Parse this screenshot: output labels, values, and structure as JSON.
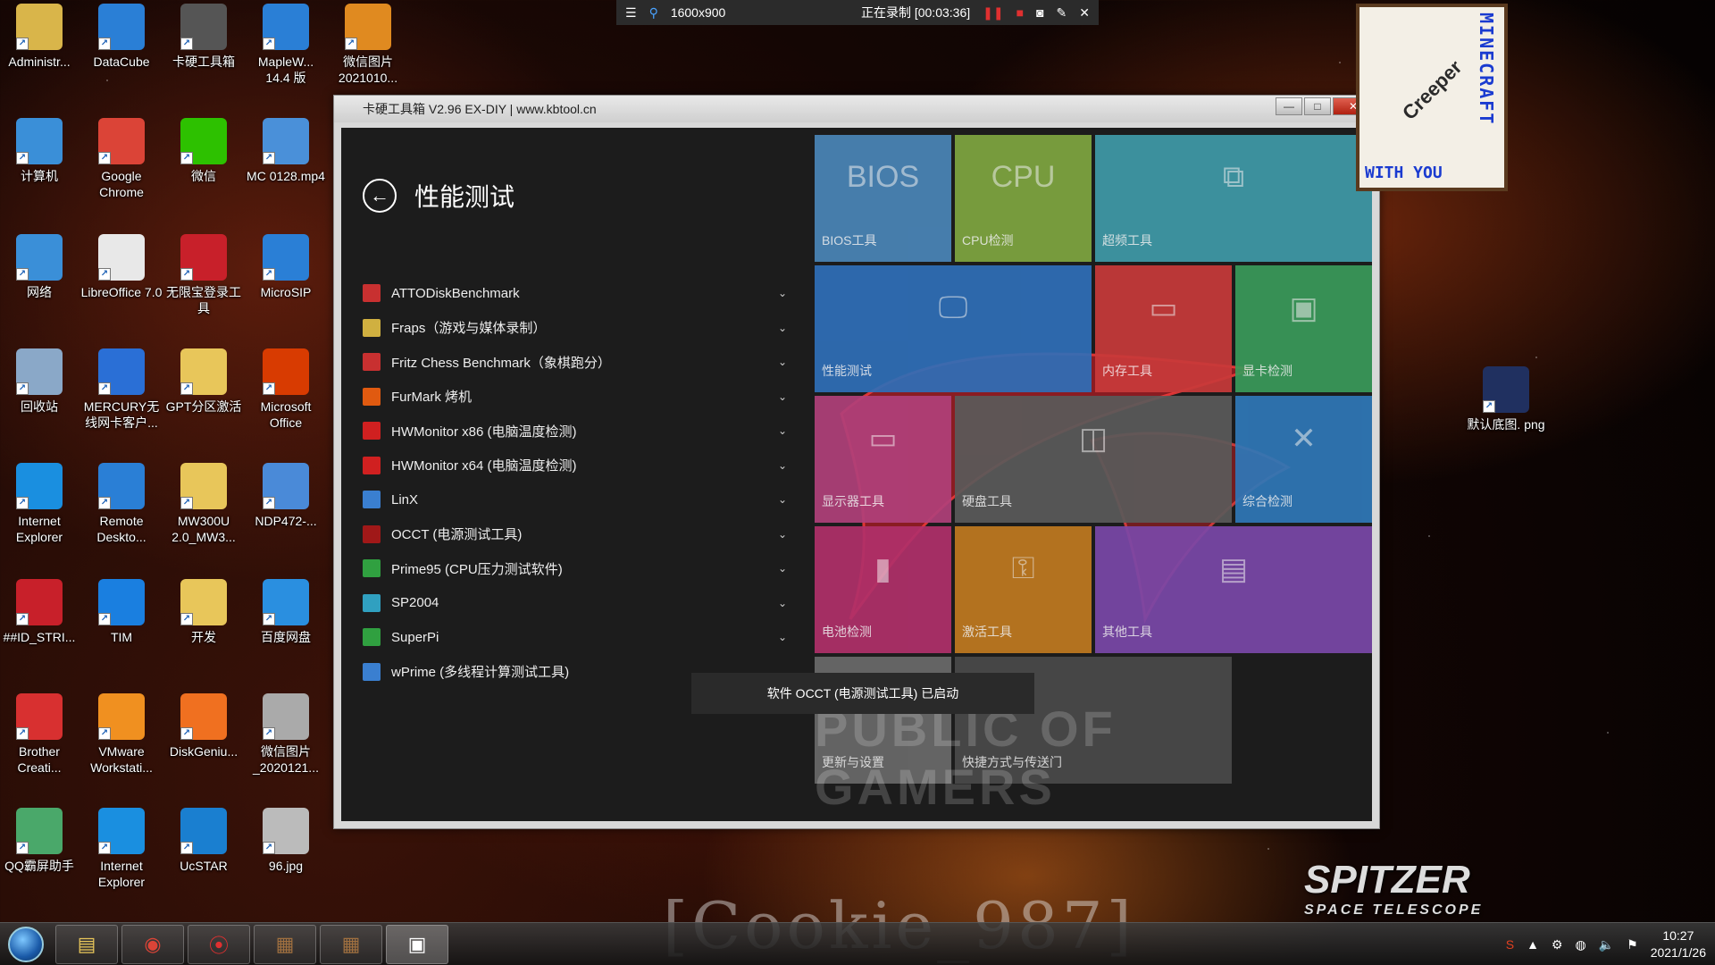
{
  "recording_bar": {
    "menu_icon": "hamburger-icon",
    "resolution": "1600x900",
    "status": "正在录制 [00:03:36]"
  },
  "desktop_icons": [
    {
      "label": "Administr...",
      "icon": "user-folder-icon",
      "color": "#d9b54a"
    },
    {
      "label": "DataCube",
      "icon": "cube-icon",
      "color": "#2a7fd6"
    },
    {
      "label": "卡硬工具箱",
      "icon": "toolbox-icon",
      "color": "#555555"
    },
    {
      "label": "MapleW... 14.4 版",
      "icon": "cloud-icon",
      "color": "#2a7fd6"
    },
    {
      "label": "微信图片 2021010...",
      "icon": "image-icon",
      "color": "#e08a20"
    },
    {
      "label": "计算机",
      "icon": "computer-icon",
      "color": "#3a8fd8"
    },
    {
      "label": "Google Chrome",
      "icon": "chrome-icon",
      "color": "#db4437"
    },
    {
      "label": "微信",
      "icon": "wechat-icon",
      "color": "#2dc100"
    },
    {
      "label": "MC 0128.mp4",
      "icon": "video-icon",
      "color": "#4a90d9"
    },
    {
      "label": "网络",
      "icon": "network-icon",
      "color": "#3a8fd8"
    },
    {
      "label": "LibreOffice 7.0",
      "icon": "document-icon",
      "color": "#e8e8e8"
    },
    {
      "label": "无限宝登录工具",
      "icon": "app-icon",
      "color": "#c8202a"
    },
    {
      "label": "MicroSIP",
      "icon": "phone-icon",
      "color": "#2a7fd6"
    },
    {
      "label": "回收站",
      "icon": "recycle-bin-icon",
      "color": "#8aa8c8"
    },
    {
      "label": "MERCURY无线网卡客户...",
      "icon": "signal-icon",
      "color": "#2a6fd6"
    },
    {
      "label": "GPT分区激活",
      "icon": "folder-icon",
      "color": "#e8c65a"
    },
    {
      "label": "Microsoft Office",
      "icon": "office-icon",
      "color": "#d83b01"
    },
    {
      "label": "Internet Explorer",
      "icon": "ie-icon",
      "color": "#1a8fe0"
    },
    {
      "label": "Remote Deskto...",
      "icon": "remote-desktop-icon",
      "color": "#2a7fd6"
    },
    {
      "label": "MW300U 2.0_MW3...",
      "icon": "folder-icon",
      "color": "#e8c65a"
    },
    {
      "label": "NDP472-...",
      "icon": "installer-icon",
      "color": "#4a8ad8"
    },
    {
      "label": "##ID_STRI...",
      "icon": "app-icon",
      "color": "#c8202a"
    },
    {
      "label": "TIM",
      "icon": "tim-icon",
      "color": "#1a7fe0"
    },
    {
      "label": "开发",
      "icon": "folder-icon",
      "color": "#e8c65a"
    },
    {
      "label": "百度网盘",
      "icon": "baidu-cloud-icon",
      "color": "#2a8fe0"
    },
    {
      "label": "Brother Creati...",
      "icon": "brother-icon",
      "color": "#d83030"
    },
    {
      "label": "VMware Workstati...",
      "icon": "vmware-icon",
      "color": "#f09020"
    },
    {
      "label": "DiskGeniu...",
      "icon": "disk-genius-icon",
      "color": "#f07020"
    },
    {
      "label": "微信图片 _2020121...",
      "icon": "image-icon",
      "color": "#aaaaaa"
    },
    {
      "label": "QQ霸屏助手",
      "icon": "qq-screen-icon",
      "color": "#4aa86a"
    },
    {
      "label": "Internet Explorer",
      "icon": "ie-icon",
      "color": "#1a8fe0"
    },
    {
      "label": "UcSTAR",
      "icon": "ucstar-icon",
      "color": "#1a7fd0"
    },
    {
      "label": "96.jpg",
      "icon": "image-icon",
      "color": "#bbbbbb"
    },
    {
      "label": "默认底图. png",
      "icon": "image-icon",
      "color": "#203060"
    }
  ],
  "window": {
    "title": "卡硬工具箱 V2.96  EX-DIY    |  www.kbtool.cn",
    "minimize": "—",
    "maximize": "□",
    "close": "✕"
  },
  "panel": {
    "title": "性能测试",
    "items": [
      {
        "label": "ATTODiskBenchmark",
        "icon_color": "#c83030"
      },
      {
        "label": "Fraps（游戏与媒体录制）",
        "icon_color": "#d0b040"
      },
      {
        "label": "Fritz Chess Benchmark（象棋跑分）",
        "icon_color": "#c83030"
      },
      {
        "label": "FurMark 烤机",
        "icon_color": "#e05a10"
      },
      {
        "label": "HWMonitor x86 (电脑温度检测)",
        "icon_color": "#d02020"
      },
      {
        "label": "HWMonitor x64 (电脑温度检测)",
        "icon_color": "#d02020"
      },
      {
        "label": "LinX",
        "icon_color": "#3a7fd0"
      },
      {
        "label": "OCCT (电源测试工具)",
        "icon_color": "#a01818"
      },
      {
        "label": "Prime95 (CPU压力测试软件)",
        "icon_color": "#30a040"
      },
      {
        "label": "SP2004",
        "icon_color": "#30a0c0"
      },
      {
        "label": "SuperPi",
        "icon_color": "#30a040"
      },
      {
        "label": "wPrime (多线程计算测试工具)",
        "icon_color": "#3a7fd0"
      }
    ]
  },
  "tiles": [
    {
      "label": "BIOS工具",
      "icon_text": "BIOS",
      "color": "#4a86b8"
    },
    {
      "label": "CPU检测",
      "icon_text": "CPU",
      "color": "#7fa640"
    },
    {
      "label": "超频工具",
      "icon_text": "⧉",
      "color": "#3f9aa8"
    },
    {
      "label": "性能测试",
      "icon_text": "🖵",
      "color": "#2f6fb8"
    },
    {
      "label": "内存工具",
      "icon_text": "▭",
      "color": "#c83a3a"
    },
    {
      "label": "显卡检测",
      "icon_text": "▣",
      "color": "#3a9a5a"
    },
    {
      "label": "显示器工具",
      "icon_text": "▭",
      "color": "#b0407a"
    },
    {
      "label": "硬盘工具",
      "icon_text": "◫",
      "color": "#5a5a5a"
    },
    {
      "label": "综合检测",
      "icon_text": "✕",
      "color": "#2f78b8"
    },
    {
      "label": "电池检测",
      "icon_text": "▮",
      "color": "#b0306a"
    },
    {
      "label": "激活工具",
      "icon_text": "⚿",
      "color": "#c07a20"
    },
    {
      "label": "其他工具",
      "icon_text": "▤",
      "color": "#7a48a8"
    },
    {
      "label": "更新与设置",
      "icon_text": "",
      "color": "#6a6a6a"
    },
    {
      "label": "快捷方式与传送门",
      "icon_text": "",
      "color": "#4a4a4a"
    }
  ],
  "toast": "软件 OCCT (电源测试工具) 已启动",
  "sticker": {
    "vertical": "MINECRAFT",
    "diagonal": "Creeper",
    "bottom": "WITH YOU"
  },
  "wallpaper": {
    "logo_title": "SPITZER",
    "logo_sub": "SPACE TELESCOPE",
    "watermark": "[Cookie_987]"
  },
  "taskbar": {
    "clock_time": "10:27",
    "clock_date": "2021/1/26"
  }
}
